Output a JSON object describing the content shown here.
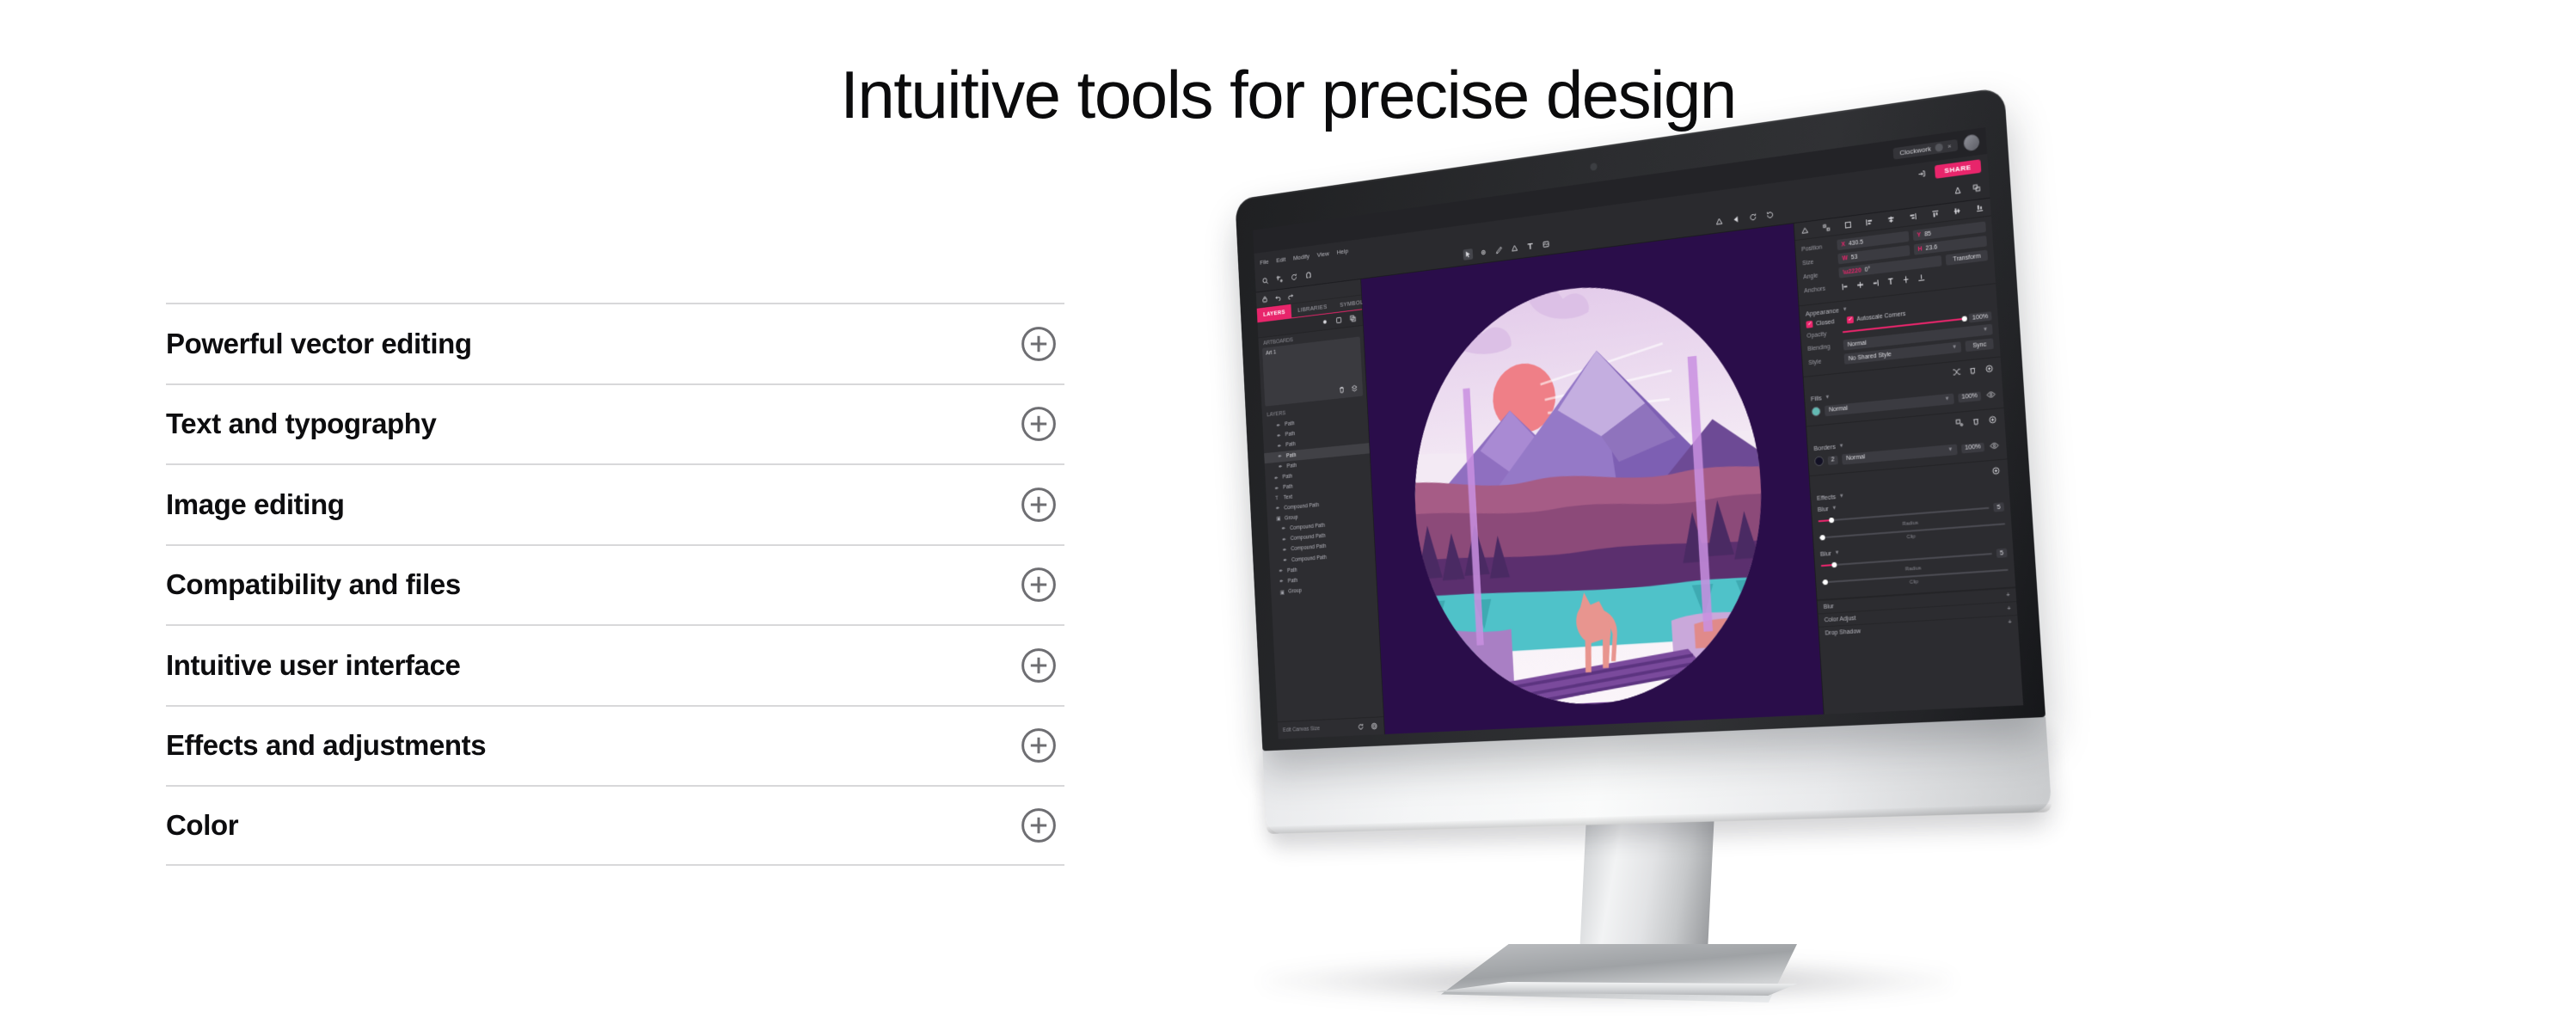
{
  "headline": "Intuitive tools for precise design",
  "accordion": {
    "items": [
      {
        "label": "Powerful vector editing",
        "icon": "plus-circle-icon"
      },
      {
        "label": "Text and typography",
        "icon": "plus-circle-icon"
      },
      {
        "label": "Image editing",
        "icon": "plus-circle-icon"
      },
      {
        "label": "Compatibility and files",
        "icon": "plus-circle-icon"
      },
      {
        "label": "Intuitive user interface",
        "icon": "plus-circle-icon"
      },
      {
        "label": "Effects and adjustments",
        "icon": "plus-circle-icon"
      },
      {
        "label": "Color",
        "icon": "plus-circle-icon"
      }
    ]
  },
  "colors": {
    "text": "#0d0d0f",
    "divider": "#d8d8da",
    "toggle": "#6e6e72",
    "accent": "#e8256b",
    "app_bg": "#2c2c30",
    "canvas_bg": "#2a0d4a",
    "monitor_chassis": "#2b2c2f",
    "monitor_chin": "#f0f1f2"
  },
  "device": {
    "type": "desktop-monitor",
    "screen_app": "vector-design-app"
  },
  "app": {
    "topbar": {
      "document_chip": "Clockwork",
      "close_label": "×",
      "avatar": "user-avatar"
    },
    "menubar": {
      "items": [
        "File",
        "Edit",
        "Modify",
        "View",
        "Help"
      ],
      "export_icon": "export-icon",
      "share_label": "SHARE"
    },
    "toolbar": {
      "left_tools": [
        "lock-icon",
        "undo-icon",
        "redo-icon"
      ],
      "center_tools": [
        "move-tool-icon",
        "node-tool-icon",
        "pen-tool-icon",
        "shape-tool-icon",
        "text-tool-icon",
        "frame-tool-icon"
      ],
      "boolean_tools": [
        "boolean-add-icon",
        "boolean-subtract-icon",
        "boolean-intersect-icon",
        "boolean-divide-icon"
      ],
      "snap_tools": [
        "zoom-icon",
        "distribute-icon",
        "rotate-icon",
        "magnet-icon"
      ],
      "mask_tools": [
        "mask-icon",
        "group-icon"
      ]
    },
    "left_panel": {
      "tabs": [
        {
          "label": "LAYERS",
          "active": true
        },
        {
          "label": "LIBRARIES",
          "active": false
        },
        {
          "label": "SYMBOLS",
          "active": false
        }
      ],
      "artboards_label": "ARTBOARDS",
      "artboard_name": "Art 1",
      "layers_label": "LAYERS",
      "layers": [
        {
          "name": "Path",
          "icon": "path-icon",
          "indent": 2,
          "selected": false
        },
        {
          "name": "Path",
          "icon": "path-icon",
          "indent": 2,
          "selected": false
        },
        {
          "name": "Path",
          "icon": "path-icon",
          "indent": 2,
          "selected": false
        },
        {
          "name": "Path",
          "icon": "path-icon",
          "indent": 2,
          "selected": true
        },
        {
          "name": "Path",
          "icon": "path-icon",
          "indent": 2,
          "selected": false
        },
        {
          "name": "Path",
          "icon": "path-icon",
          "indent": 1,
          "selected": false
        },
        {
          "name": "Path",
          "icon": "path-icon",
          "indent": 1,
          "selected": false
        },
        {
          "name": "Text",
          "icon": "text-icon",
          "indent": 1,
          "selected": false
        },
        {
          "name": "Compound Path",
          "icon": "path-icon",
          "indent": 1,
          "selected": false
        },
        {
          "name": "Group",
          "icon": "group-icon",
          "indent": 1,
          "selected": false
        },
        {
          "name": "Compound Path",
          "icon": "path-icon",
          "indent": 2,
          "selected": false
        },
        {
          "name": "Compound Path",
          "icon": "path-icon",
          "indent": 2,
          "selected": false
        },
        {
          "name": "Compound Path",
          "icon": "path-icon",
          "indent": 2,
          "selected": false
        },
        {
          "name": "Compound Path",
          "icon": "path-icon",
          "indent": 2,
          "selected": false
        },
        {
          "name": "Path",
          "icon": "path-icon",
          "indent": 1,
          "selected": false
        },
        {
          "name": "Path",
          "icon": "path-icon",
          "indent": 1,
          "selected": false
        },
        {
          "name": "Group",
          "icon": "group-icon",
          "indent": 1,
          "selected": false
        }
      ],
      "footer_label": "Edit Canvas Size"
    },
    "right_panel": {
      "position_label": "Position",
      "position_x": "430.5",
      "position_y": "85",
      "size_label": "Size",
      "size_w": "53",
      "size_h": "23.6",
      "angle_label": "Angle",
      "angle_value": "0°",
      "anchors_label": "Anchors",
      "transform_label": "Transform",
      "appearance_label": "Appearance",
      "closed_label": "Closed",
      "autoscale_label": "Autoscale Corners",
      "opacity_label": "Opacity",
      "opacity_value": "100%",
      "blending_label": "Blending",
      "blending_value": "Normal",
      "style_label": "Style",
      "style_value": "No Shared Style",
      "sync_label": "Sync",
      "fills_label": "Fills",
      "fill_mode": "Normal",
      "fill_opacity": "100%",
      "borders_label": "Borders",
      "border_width": "2",
      "border_mode": "Normal",
      "border_opacity": "100%",
      "effects_label": "Effects",
      "blur_label": "Blur",
      "blur_value": "5",
      "radius_label": "Radius",
      "clip_label": "Clip",
      "blur2_label": "Blur",
      "blur2_value": "5",
      "radius2_label": "Radius",
      "clip2_label": "Clip",
      "effect_rows": [
        "Blur",
        "Color Adjust",
        "Drop Shadow"
      ],
      "add_symbol": "+"
    }
  },
  "artwork": {
    "title": "mountain-wolf-landscape",
    "palette": {
      "background": "#2a0d4a",
      "sky_light": "#f5eef5",
      "cloud_pink": "#dcc0e6",
      "sun": "#ef7f87",
      "mountain_light": "#a486cf",
      "mountain_mid": "#8566b4",
      "mountain_dark": "#5b3d86",
      "hills_rose": "#a65c86",
      "hills_mauve": "#7b4878",
      "water": "#4fc2c9",
      "wolf": "#e8958f",
      "rock_light": "#c9a8da"
    }
  }
}
